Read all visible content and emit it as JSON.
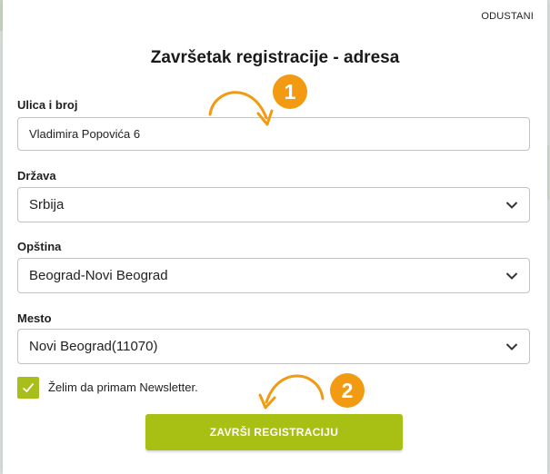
{
  "dialog": {
    "cancel_label": "ODUSTANI",
    "title": "Završetak registracije - adresa"
  },
  "form": {
    "street": {
      "label": "Ulica i broj",
      "value": "Vladimira Popovića 6"
    },
    "country": {
      "label": "Država",
      "value": "Srbija"
    },
    "municipality": {
      "label": "Opština",
      "value": "Beograd-Novi Beograd"
    },
    "place": {
      "label": "Mesto",
      "value": "Novi Beograd(11070)"
    },
    "newsletter": {
      "label": "Želim da primam Newsletter.",
      "checked": true
    },
    "submit_label": "ZAVRŠI REGISTRACIJU"
  },
  "annotations": {
    "step1": "1",
    "step2": "2",
    "color": "#f29a12"
  },
  "colors": {
    "accent": "#a8bf14",
    "border": "#c3c3c3"
  }
}
